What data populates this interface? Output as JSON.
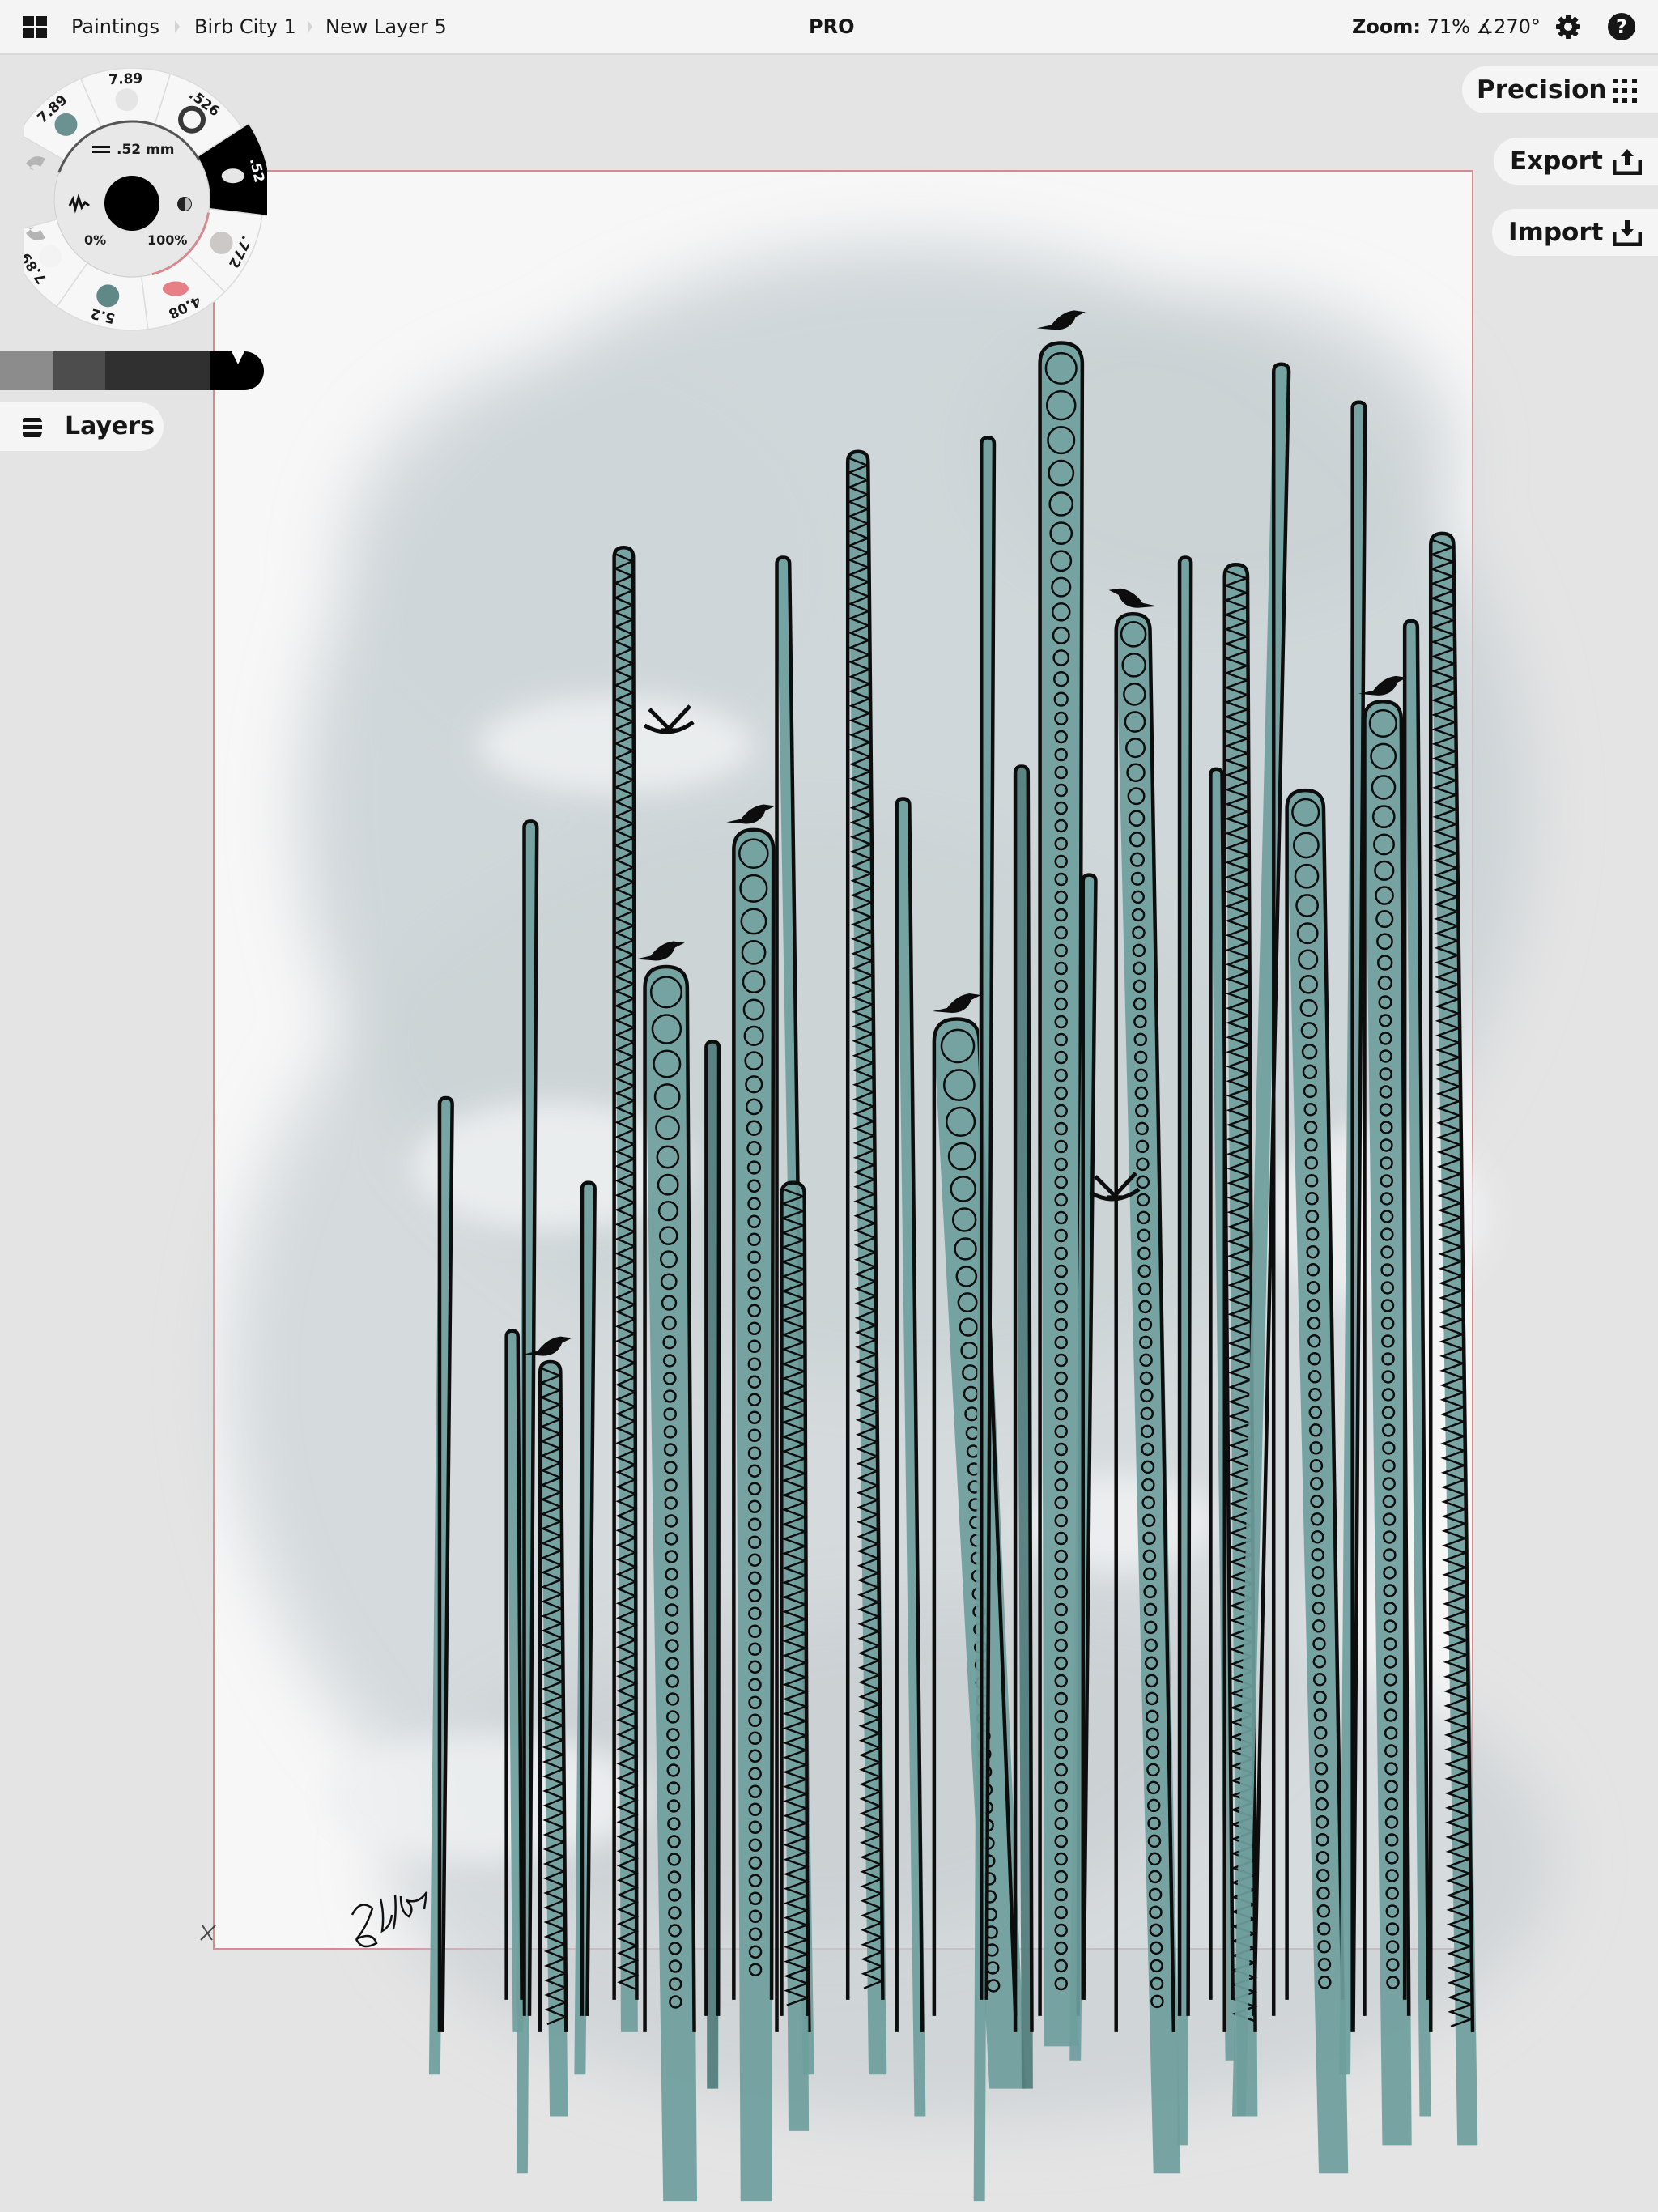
{
  "topbar": {
    "breadcrumb": [
      "Paintings",
      "Birb City 1",
      "New Layer 5"
    ],
    "badge": "PRO",
    "zoom_label": "Zoom:",
    "zoom_value": "71%",
    "rotation_value": "∡270°",
    "icons": {
      "menu": "grid-icon",
      "settings": "gear-icon",
      "help": "help-icon"
    },
    "help_glyph": "?"
  },
  "brush_wheel": {
    "size_readout": ".52 mm",
    "smoothing": "0%",
    "opacity": "100%",
    "presets": [
      {
        "label": "7.89",
        "swatch": "soft-teal-dot"
      },
      {
        "label": "7.89",
        "swatch": "faint-spray"
      },
      {
        "label": ".526",
        "swatch": "rough-ring"
      },
      {
        "label": ".52",
        "swatch": "ink-blob",
        "selected": true
      },
      {
        "label": ".772",
        "swatch": "grey-grain"
      },
      {
        "label": "4.08",
        "swatch": "eraser"
      },
      {
        "label": "5.2",
        "swatch": "teal-wash"
      },
      {
        "label": "7.89",
        "swatch": "blank"
      }
    ],
    "current_color": "#000000"
  },
  "color_history": [
    "#8c8c8c",
    "#4d4d4d",
    "#303030",
    "#000000"
  ],
  "layers_button": {
    "label": "Layers",
    "icon": "layers-icon"
  },
  "right_buttons": [
    {
      "label": "Precision",
      "icon": "dot-grid-icon"
    },
    {
      "label": "Export",
      "icon": "upload-icon"
    },
    {
      "label": "Import",
      "icon": "download-icon"
    }
  ],
  "artwork": {
    "signature": "ZUR",
    "colors": {
      "teal": "#6e9e9c",
      "teal_dark": "#4f7c7b",
      "ink": "#0d0d0d",
      "wash": "#cdd4d7",
      "paper": "#f7f7f7",
      "paper_border": "#d98a8f"
    }
  }
}
